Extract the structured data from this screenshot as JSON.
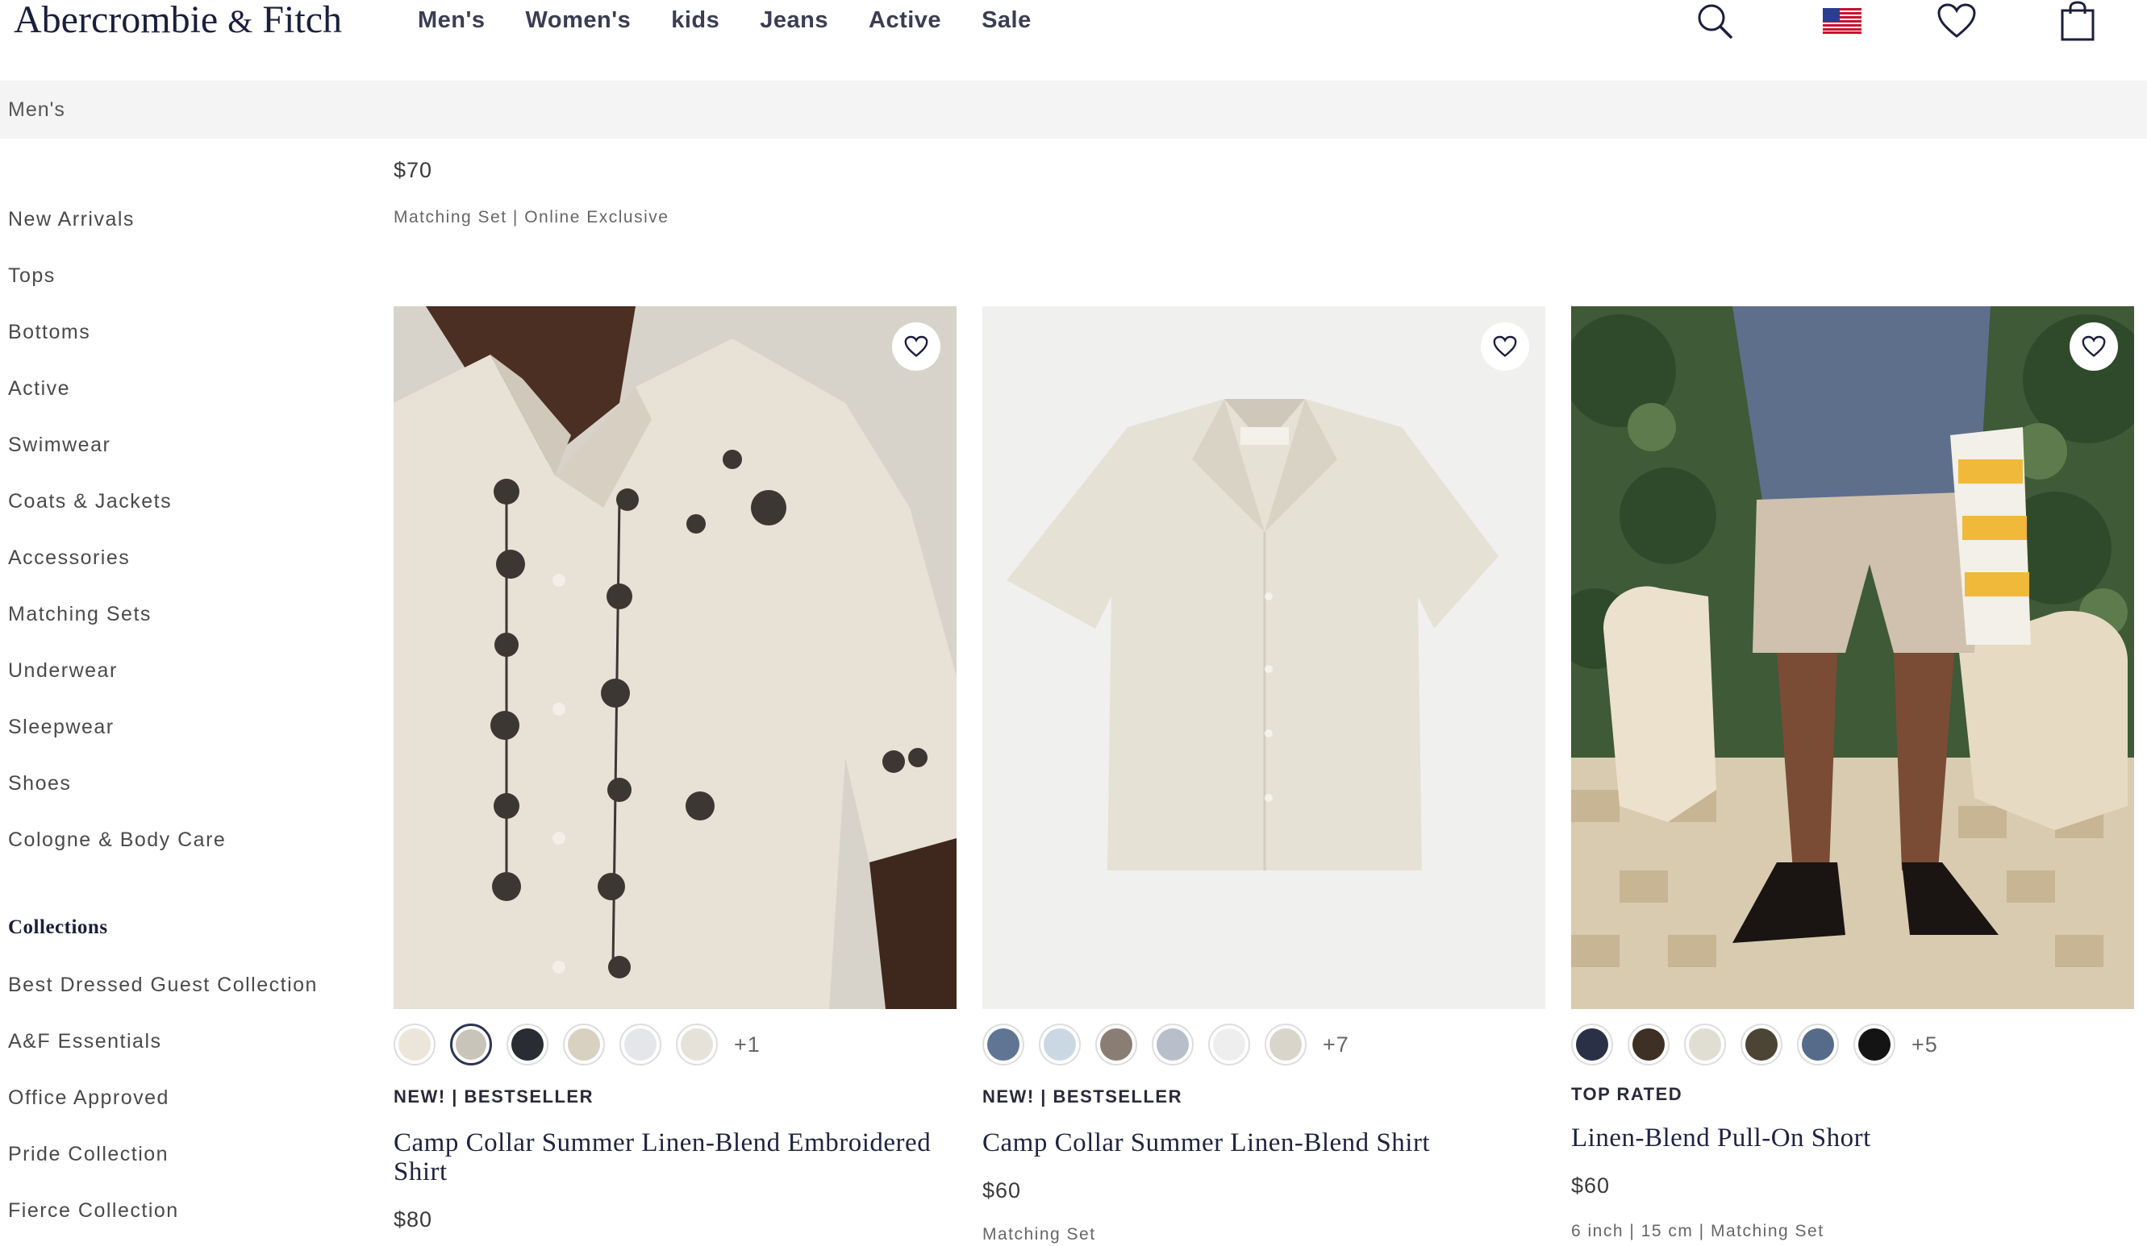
{
  "brand": {
    "name_part1": "Abercrombie",
    "amp": "&",
    "name_part2": "Fitch"
  },
  "nav": {
    "items": [
      "Men's",
      "Women's",
      "kids",
      "Jeans",
      "Active",
      "Sale"
    ]
  },
  "header_icons": [
    "search-icon",
    "us-flag-icon",
    "heart-icon",
    "shopping-bag-icon"
  ],
  "breadcrumb": {
    "current": "Men's"
  },
  "sidebar": {
    "categories": [
      "New Arrivals",
      "Tops",
      "Bottoms",
      "Active",
      "Swimwear",
      "Coats & Jackets",
      "Accessories",
      "Matching Sets",
      "Underwear",
      "Sleepwear",
      "Shoes",
      "Cologne & Body Care"
    ],
    "collections_heading": "Collections",
    "collections": [
      "Best Dressed Guest Collection",
      "A&F Essentials",
      "Office Approved",
      "Pride Collection",
      "Fierce Collection"
    ]
  },
  "previous_item": {
    "price": "$70",
    "meta": "Matching Set | Online Exclusive"
  },
  "products": [
    {
      "badge": "NEW! | BESTSELLER",
      "name": "Camp Collar Summer Linen-Blend Embroidered Shirt",
      "price": "$80",
      "meta": "",
      "swatch_colors": [
        "#ece6da",
        "#c9c4ba",
        "#2a2c33",
        "#d8d0c0",
        "#e4e6ea",
        "#e6e2da"
      ],
      "selected_swatch": 1,
      "more_colors": "+1"
    },
    {
      "badge": "NEW! | BESTSELLER",
      "name": "Camp Collar Summer Linen-Blend Shirt",
      "price": "$60",
      "meta": "Matching Set",
      "swatch_colors": [
        "#5f7593",
        "#c9d8e2",
        "#8a7d73",
        "#b8bfca",
        "#eeeeee",
        "#d9d5ca"
      ],
      "selected_swatch": -1,
      "more_colors": "+7"
    },
    {
      "badge": "TOP RATED",
      "name": "Linen-Blend Pull-On Short",
      "price": "$60",
      "meta": "6 inch | 15 cm | Matching Set",
      "swatch_colors": [
        "#2a3146",
        "#3e3024",
        "#e0ddd2",
        "#4c4434",
        "#566b8a",
        "#141414"
      ],
      "selected_swatch": -1,
      "more_colors": "+5"
    }
  ],
  "colors": {
    "brand_navy": "#1a1f3d",
    "subbar_bg": "#f4f4f4"
  }
}
